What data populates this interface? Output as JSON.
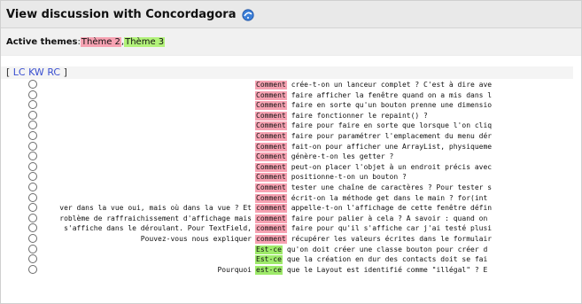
{
  "window": {
    "title": "View discussion with Concordagora",
    "help_icon": "help-icon"
  },
  "themes": {
    "label": "Active themes",
    "colon": " : ",
    "items": [
      "Thème 2",
      "Thème 3"
    ],
    "separator": ", ",
    "colors": {
      "theme2": "#f6a2b2",
      "theme3": "#b2f27a"
    }
  },
  "modes": {
    "open": "[",
    "links": [
      "LC",
      "KW",
      "RC"
    ],
    "close": "]"
  },
  "rows": [
    {
      "left": "",
      "kw": "Comment",
      "right": "crée-t-on un lanceur complet ? C'est à dire ave",
      "color": "pink"
    },
    {
      "left": "",
      "kw": "Comment",
      "right": "faire afficher la fenêtre quand on a mis dans l",
      "color": "pink"
    },
    {
      "left": "",
      "kw": "Comment",
      "right": "faire en sorte qu'un bouton prenne une dimensio",
      "color": "pink"
    },
    {
      "left": "",
      "kw": "Comment",
      "right": "faire fonctionner le repaint() ?",
      "color": "pink"
    },
    {
      "left": "",
      "kw": "Comment",
      "right": "faire pour faire en sorte que lorsque l'on cliq",
      "color": "pink"
    },
    {
      "left": "",
      "kw": "Comment",
      "right": "faire pour paramétrer l'emplacement du menu dér",
      "color": "pink"
    },
    {
      "left": "",
      "kw": "Comment",
      "right": "fait-on pour afficher une ArrayList, physiqueme",
      "color": "pink"
    },
    {
      "left": "",
      "kw": "Comment",
      "right": "génère-t-on les getter ?",
      "color": "pink"
    },
    {
      "left": "",
      "kw": "Comment",
      "right": "peut-on placer l'objet à un endroit précis avec",
      "color": "pink"
    },
    {
      "left": "",
      "kw": "Comment",
      "right": "positionne-t-on un bouton ?",
      "color": "pink"
    },
    {
      "left": "",
      "kw": "Comment",
      "right": "tester une chaîne de caractères ? Pour tester s",
      "color": "pink"
    },
    {
      "left": "",
      "kw": "Comment",
      "right": "écrit-on la méthode get dans le main ? for(int",
      "color": "pink"
    },
    {
      "left": "ver dans la vue oui, mais où dans la vue ? Et",
      "kw": "comment",
      "right": "appelle-t-on l'affichage de cette fenêtre défin",
      "color": "pink"
    },
    {
      "left": "roblème de raffraichissement d'affichage mais",
      "kw": "comment",
      "right": "faire pour palier à cela ? A savoir : quand on",
      "color": "pink"
    },
    {
      "left": "s'affiche dans le déroulant. Pour TextField,",
      "kw": "comment",
      "right": "faire pour qu'il s'affiche car j'ai testé plusi",
      "color": "pink"
    },
    {
      "left": "Pouvez-vous nous expliquer",
      "kw": "comment",
      "right": "récupérer les valeurs écrites dans le formulair",
      "color": "pink"
    },
    {
      "left": "",
      "kw": "Est-ce",
      "right": "qu'on doit créer une classe bouton pour créer d",
      "color": "green"
    },
    {
      "left": "",
      "kw": "Est-ce",
      "right": "que la création en dur des contacts doit se fai",
      "color": "green"
    },
    {
      "left": "Pourquoi",
      "kw": "est-ce",
      "right": "que le Layout est identifié comme \"illégal\" ? E",
      "color": "green"
    }
  ]
}
